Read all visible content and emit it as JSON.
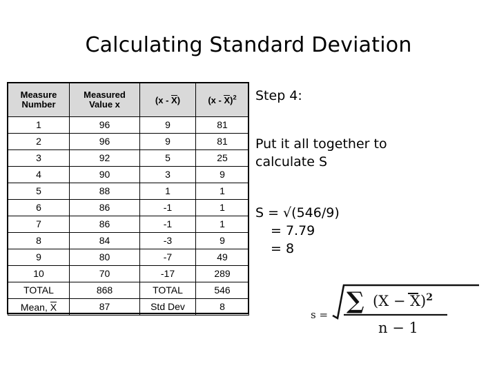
{
  "slide": {
    "title": "Calculating Standard Deviation"
  },
  "table": {
    "headers": [
      "Measure Number",
      "Measured Value x",
      "(x - X)",
      "(x - X)2"
    ],
    "header_parts": {
      "c1_line1": "Measure",
      "c1_line2": "Number",
      "c2_line1": "Measured",
      "c2_line2": "Value x",
      "c3_open": "(x - ",
      "c3_bar": "X",
      "c3_close": ")",
      "c4_open": "(x - ",
      "c4_bar": "X",
      "c4_close": ")",
      "c4_sup": "2"
    },
    "rows": [
      {
        "n": "1",
        "x": "96",
        "dev": "9",
        "sq": "81"
      },
      {
        "n": "2",
        "x": "96",
        "dev": "9",
        "sq": "81"
      },
      {
        "n": "3",
        "x": "92",
        "dev": "5",
        "sq": "25"
      },
      {
        "n": "4",
        "x": "90",
        "dev": "3",
        "sq": "9"
      },
      {
        "n": "5",
        "x": "88",
        "dev": "1",
        "sq": "1"
      },
      {
        "n": "6",
        "x": "86",
        "dev": "-1",
        "sq": "1"
      },
      {
        "n": "7",
        "x": "86",
        "dev": "-1",
        "sq": "1"
      },
      {
        "n": "8",
        "x": "84",
        "dev": "-3",
        "sq": "9"
      },
      {
        "n": "9",
        "x": "80",
        "dev": "-7",
        "sq": "49"
      },
      {
        "n": "10",
        "x": "70",
        "dev": "-17",
        "sq": "289"
      }
    ],
    "total_row": {
      "label": "TOTAL",
      "x": "868",
      "dev_label": "TOTAL",
      "sq": "546"
    },
    "mean_row": {
      "label_text": "Mean, ",
      "label_bar": "X",
      "x": "87",
      "dev_label": "Std Dev",
      "sq": "8"
    }
  },
  "notes": {
    "step_label": "Step 4:",
    "instruction_line1": "Put it all together to",
    "instruction_line2": "calculate S",
    "calc_line1": "S = √(546/9)",
    "calc_line2": "= 7.79",
    "calc_line3": "= 8"
  },
  "formula": {
    "lhs": "s =",
    "numerator_sigma": "∑",
    "numerator_expr_open": "(X − ",
    "numerator_bar": "X",
    "numerator_expr_close": ")",
    "numerator_sup": "2",
    "denominator": "n − 1"
  },
  "colors": {
    "background": "#ffffff",
    "text": "#000000",
    "header_fill": "#d9d9d9",
    "border": "#000000"
  }
}
